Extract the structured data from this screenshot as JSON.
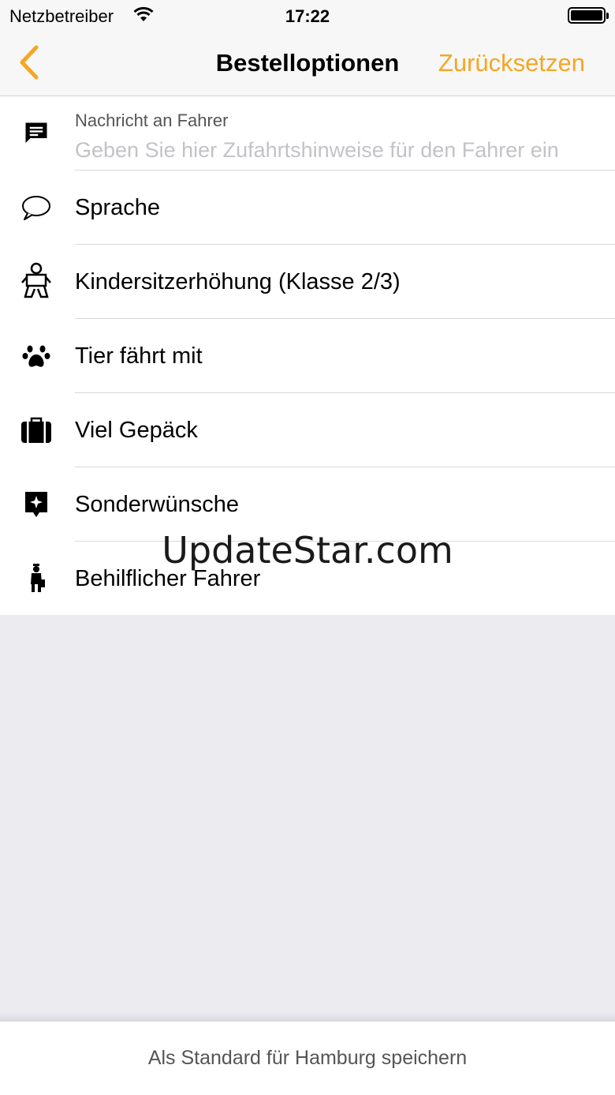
{
  "status_bar": {
    "carrier": "Netzbetreiber",
    "time": "17:22"
  },
  "nav": {
    "title": "Bestelloptionen",
    "reset_label": "Zurücksetzen",
    "accent_color": "#f5a623"
  },
  "message": {
    "title": "Nachricht an Fahrer",
    "placeholder": "Geben Sie hier Zufahrtshinweise für den Fahrer ein",
    "value": ""
  },
  "options": [
    {
      "label": "Sprache",
      "icon": "speech-bubble-icon"
    },
    {
      "label": "Kindersitzerhöhung (Klasse 2/3)",
      "icon": "baby-icon"
    },
    {
      "label": "Tier fährt mit",
      "icon": "paw-icon"
    },
    {
      "label": "Viel Gepäck",
      "icon": "suitcase-icon"
    },
    {
      "label": "Sonderwünsche",
      "icon": "star-tag-icon"
    },
    {
      "label": "Behilflicher Fahrer",
      "icon": "porter-icon"
    }
  ],
  "watermark": "UpdateStar.com",
  "footer": {
    "save_label": "Als Standard für Hamburg speichern"
  }
}
